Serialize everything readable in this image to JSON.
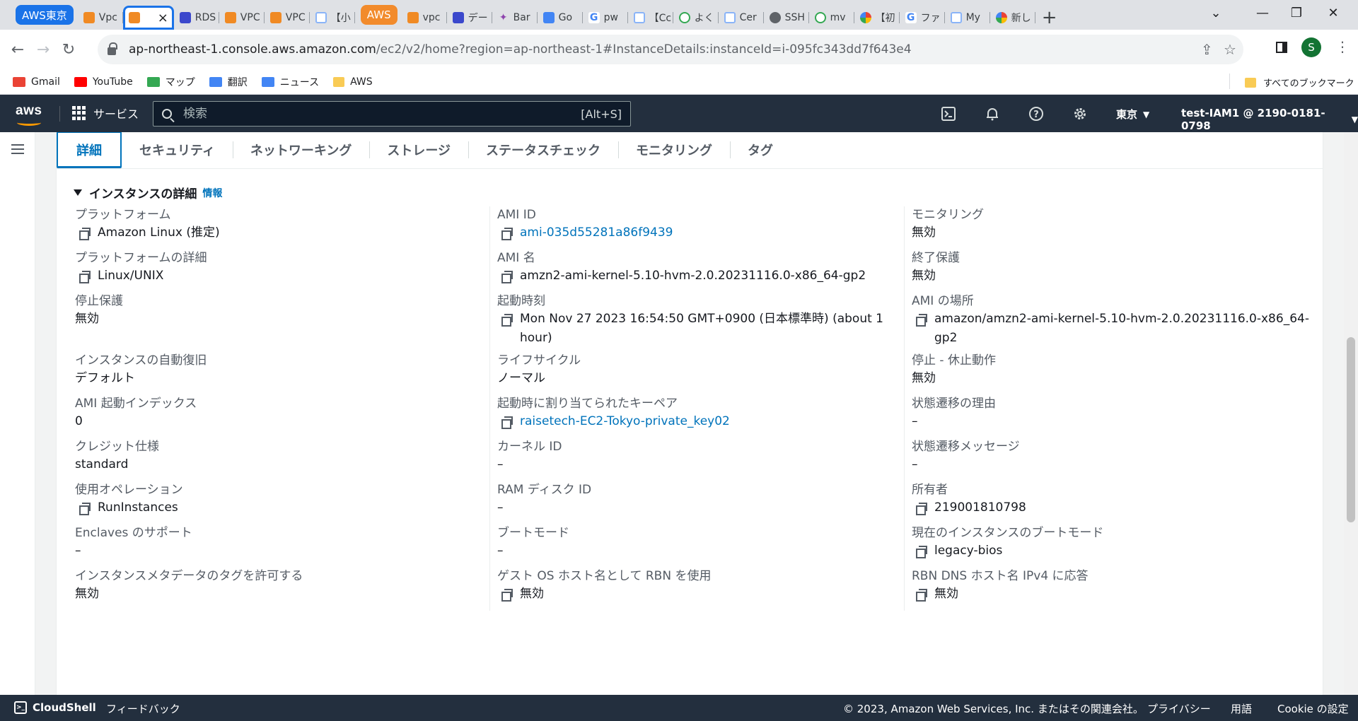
{
  "browser": {
    "tab_groups": [
      {
        "label": "AWS東京",
        "color": "#1a73e8"
      },
      {
        "label": "AWS",
        "color": "#f28b2c"
      }
    ],
    "tabs_before": [
      {
        "label": "Vpc",
        "icon": "ec2-icon"
      }
    ],
    "active_tab": {
      "label": "",
      "icon": "ec2-icon"
    },
    "tabs_middle": [
      {
        "label": "RDS",
        "icon": "rds-icon"
      },
      {
        "label": "VPC",
        "icon": "ec2-icon"
      },
      {
        "label": "VPC",
        "icon": "ec2-icon"
      },
      {
        "label": "【小",
        "icon": "page-icon"
      }
    ],
    "tabs_after": [
      {
        "label": "vpc",
        "icon": "ec2-icon"
      },
      {
        "label": "デー",
        "icon": "rds-icon"
      },
      {
        "label": "Bar",
        "icon": "bard-icon"
      },
      {
        "label": "Go",
        "icon": "translate-icon"
      },
      {
        "label": "pw",
        "icon": "google-icon"
      },
      {
        "label": "【Cc",
        "icon": "page-icon"
      },
      {
        "label": "よく",
        "icon": "green-icon"
      },
      {
        "label": "Cer",
        "icon": "page-icon"
      },
      {
        "label": "SSH",
        "icon": "github-icon"
      },
      {
        "label": "mv",
        "icon": "green-icon"
      },
      {
        "label": "【初",
        "icon": "multi-icon"
      },
      {
        "label": "ファ",
        "icon": "google-icon"
      },
      {
        "label": "My",
        "icon": "page-icon"
      },
      {
        "label": "新し",
        "icon": "chrome-icon"
      }
    ],
    "url_host": "ap-northeast-1.console.aws.amazon.com",
    "url_path": "/ec2/v2/home?region=ap-northeast-1#InstanceDetails:instanceId=i-095fc343dd7f643e4",
    "profile_initial": "S",
    "bookmarks": [
      {
        "label": "Gmail",
        "color": "#ea4335"
      },
      {
        "label": "YouTube",
        "color": "#ff0000"
      },
      {
        "label": "マップ",
        "color": "#34a853"
      },
      {
        "label": "翻訳",
        "color": "#4285f4"
      },
      {
        "label": "ニュース",
        "color": "#4285f4"
      },
      {
        "label": "AWS",
        "color": "#f9cb55"
      }
    ],
    "all_bookmarks": "すべてのブックマーク"
  },
  "aws_header": {
    "logo": "aws",
    "services": "サービス",
    "search_placeholder": "検索",
    "search_shortcut": "[Alt+S]",
    "region": "東京",
    "account": "test-IAM1 @ 2190-0181-0798"
  },
  "detail_tabs": [
    "詳細",
    "セキュリティ",
    "ネットワーキング",
    "ストレージ",
    "ステータスチェック",
    "モニタリング",
    "タグ"
  ],
  "section": {
    "title": "インスタンスの詳細",
    "info": "情報"
  },
  "columns": [
    [
      {
        "label": "プラットフォーム",
        "value": "Amazon Linux (推定)",
        "copy": true
      },
      {
        "label": "プラットフォームの詳細",
        "value": "Linux/UNIX",
        "copy": true
      },
      {
        "label": "停止保護",
        "value": "無効",
        "copy": false,
        "rows": 3
      },
      {
        "label": "インスタンスの自動復旧",
        "value": "デフォルト",
        "copy": false
      },
      {
        "label": "AMI 起動インデックス",
        "value": "0",
        "copy": false
      },
      {
        "label": "クレジット仕様",
        "value": "standard",
        "copy": false
      },
      {
        "label": "使用オペレーション",
        "value": "RunInstances",
        "copy": true
      },
      {
        "label": "Enclaves のサポート",
        "value": "–",
        "copy": false
      },
      {
        "label": "インスタンスメタデータのタグを許可する",
        "value": "無効",
        "copy": false
      }
    ],
    [
      {
        "label": "AMI ID",
        "value": "ami-035d55281a86f9439",
        "copy": true,
        "link": true
      },
      {
        "label": "AMI 名",
        "value": "amzn2-ami-kernel-5.10-hvm-2.0.20231116.0-x86_64-gp2",
        "copy": true
      },
      {
        "label": "起動時刻",
        "value": "Mon Nov 27 2023 16:54:50 GMT+0900 (日本標準時) (about 1 hour)",
        "copy": true,
        "rows": 3
      },
      {
        "label": "ライフサイクル",
        "value": "ノーマル",
        "copy": false
      },
      {
        "label": "起動時に割り当てられたキーペア",
        "value": "raisetech-EC2-Tokyo-private_key02",
        "copy": true,
        "link": true
      },
      {
        "label": "カーネル ID",
        "value": "–",
        "copy": false
      },
      {
        "label": "RAM ディスク ID",
        "value": "–",
        "copy": false
      },
      {
        "label": "ブートモード",
        "value": "–",
        "copy": false
      },
      {
        "label": "ゲスト OS ホスト名として RBN を使用",
        "value": "無効",
        "copy": true
      }
    ],
    [
      {
        "label": "モニタリング",
        "value": "無効",
        "copy": false
      },
      {
        "label": "終了保護",
        "value": "無効",
        "copy": false
      },
      {
        "label": "AMI の場所",
        "value": "amazon/amzn2-ami-kernel-5.10-hvm-2.0.20231116.0-x86_64-gp2",
        "copy": true,
        "rows": 3
      },
      {
        "label": "停止 - 休止動作",
        "value": "無効",
        "copy": false
      },
      {
        "label": "状態遷移の理由",
        "value": "–",
        "copy": false
      },
      {
        "label": "状態遷移メッセージ",
        "value": "–",
        "copy": false
      },
      {
        "label": "所有者",
        "value": "219001810798",
        "copy": true
      },
      {
        "label": "現在のインスタンスのブートモード",
        "value": "legacy-bios",
        "copy": true
      },
      {
        "label": "RBN DNS ホスト名 IPv4 に応答",
        "value": "無効",
        "copy": true
      }
    ]
  ],
  "footer": {
    "cloudshell": "CloudShell",
    "feedback": "フィードバック",
    "copyright": "© 2023, Amazon Web Services, Inc. またはその関連会社。",
    "privacy": "プライバシー",
    "terms": "用語",
    "cookies": "Cookie の設定"
  }
}
